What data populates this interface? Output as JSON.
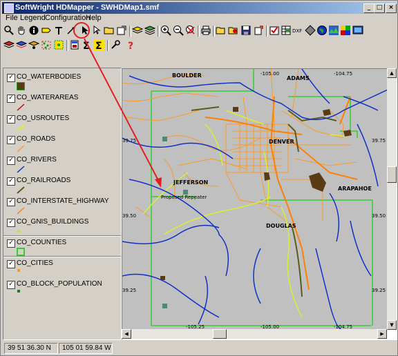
{
  "window": {
    "title": "SoftWright HDMapper - SWHDMap1.smf"
  },
  "menu": [
    {
      "label": "File"
    },
    {
      "label": "Legend"
    },
    {
      "label": "Configuration"
    },
    {
      "label": "Help"
    }
  ],
  "legend": {
    "layers": [
      {
        "label": "CO_WATERBODIES",
        "checked": "✓",
        "symbol": "swatch-fill",
        "color": "#5a3c14"
      },
      {
        "label": "CO_WATERAREAS",
        "checked": "✓",
        "symbol": "line",
        "color": "#cc0000"
      },
      {
        "label": "CO_USROUTES",
        "checked": "✓",
        "symbol": "line",
        "color": "#d8ef30"
      },
      {
        "label": "CO_ROADS",
        "checked": "✓",
        "symbol": "line",
        "color": "#ff9a20"
      },
      {
        "label": "CO_RIVERS",
        "checked": "✓",
        "symbol": "line",
        "color": "#1030c8"
      },
      {
        "label": "CO_RAILROADS",
        "checked": "✓",
        "symbol": "line",
        "color": "#5a5a20"
      },
      {
        "label": "CO_INTERSTATE_HIGHWAY",
        "checked": "✓",
        "symbol": "line",
        "color": "#ff8000"
      },
      {
        "label": "CO_GNIS_BUILDINGS",
        "checked": "✓",
        "symbol": "dot",
        "color": "#b8e830"
      },
      {
        "label": "CO_COUNTIES",
        "checked": "✓",
        "symbol": "outline",
        "color": "#30d030"
      },
      {
        "label": "CO_CITIES",
        "checked": "✓",
        "symbol": "dot",
        "color": "#ff9a20"
      },
      {
        "label": "CO_BLOCK_POPULATION",
        "checked": "✓",
        "symbol": "dot",
        "color": "#207a20"
      }
    ]
  },
  "map": {
    "graticule": {
      "top_lon": [
        "-105.00",
        "-104.75"
      ],
      "bottom_lon": [
        "-105.25",
        "-105.00",
        "-104.75"
      ],
      "left_lat": [
        "39.75",
        "39.50",
        "39.25"
      ],
      "right_lat": [
        "39.75",
        "39.50",
        "39.25"
      ]
    },
    "places": {
      "boulder": "BOULDER",
      "adams": "ADAMS",
      "denver": "DENVER",
      "jefferson": "JEFFERSON",
      "arapahoe": "ARAPAHOE",
      "douglas": "DOUGLAS"
    },
    "annotation": "Proposed Repeater",
    "colors": {
      "background": "#c0c0c0",
      "county_line": "#30d030",
      "roads": "#ff9a20",
      "rivers": "#1030c8",
      "usroutes": "#d8ef30",
      "callout": "#e02020"
    }
  },
  "status": {
    "latitude": "39 51 36.30 N",
    "longitude": "105 01 59.84 W"
  }
}
